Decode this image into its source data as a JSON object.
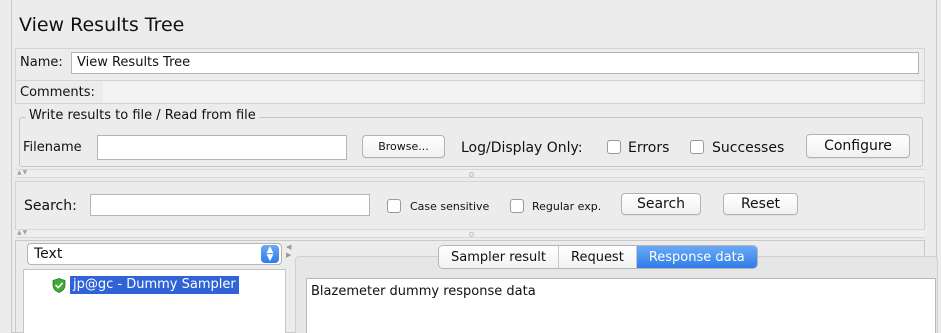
{
  "header": {
    "title": "View Results Tree"
  },
  "name_field": {
    "label": "Name:",
    "value": "View Results Tree"
  },
  "comments_field": {
    "label": "Comments:",
    "value": ""
  },
  "file_section": {
    "legend": "Write results to file / Read from file",
    "filename_label": "Filename",
    "filename_value": "",
    "browse_label": "Browse...",
    "log_display_label": "Log/Display Only:",
    "errors_label": "Errors",
    "errors_checked": false,
    "successes_label": "Successes",
    "successes_checked": false,
    "configure_label": "Configure"
  },
  "search_section": {
    "label": "Search:",
    "value": "",
    "case_sensitive_label": "Case sensitive",
    "regex_label": "Regular exp.",
    "search_button": "Search",
    "reset_button": "Reset"
  },
  "renderer": {
    "selected": "Text"
  },
  "tree": {
    "items": [
      {
        "label": "jp@gc - Dummy Sampler",
        "status": "success",
        "selected": true
      }
    ]
  },
  "result_tabs": {
    "tabs": [
      {
        "label": "Sampler result",
        "active": false
      },
      {
        "label": "Request",
        "active": false
      },
      {
        "label": "Response data",
        "active": true
      }
    ]
  },
  "response": {
    "text": "Blazemeter dummy response data"
  },
  "colors": {
    "accent": "#2f7ce9",
    "selection": "#2f63d6",
    "success_icon": "#3ea834"
  }
}
